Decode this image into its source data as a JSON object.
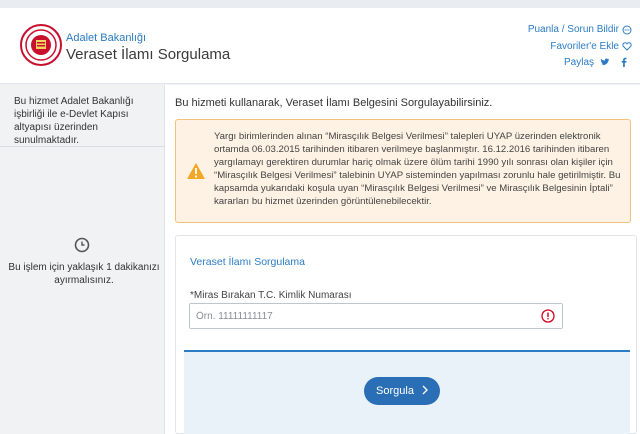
{
  "header": {
    "agency": "Adalet Bakanlığı",
    "service_title": "Veraset İlamı Sorgulama",
    "rate_report": "Puanla / Sorun Bildir",
    "add_favorites": "Favoriler'e Ekle",
    "share": "Paylaş"
  },
  "sidebar": {
    "info": "Bu hizmet Adalet Bakanlığı işbirliği ile e-Devlet Kapısı altyapısı üzerinden sunulmaktadır.",
    "time_notice": "Bu işlem için yaklaşık 1 dakikanızı ayırmalısınız."
  },
  "main": {
    "intro": "Bu hizmeti kullanarak, Veraset İlamı Belgesini Sorgulayabilirsiniz.",
    "warning": "Yargı birimlerinden alınan “Mirasçılık Belgesi Verilmesi” talepleri UYAP üzerinden elektronik ortamda 06.03.2015 tarihinden itibaren verilmeye başlanmıştır. 16.12.2016 tarihinden itibaren yargılamayı gerektiren durumlar hariç olmak üzere ölüm tarihi 1990 yılı sonrası olan kişiler için “Mirasçılık Belgesi Verilmesi” talebinin UYAP sisteminden yapılması zorunlu hale getirilmiştir. Bu kapsamda yukarıdaki koşula uyan “Mirasçılık Belgesi Verilmesi” ve Mirasçılık Belgesinin İptali” kararları bu hizmet üzerinden görüntülenebilecektir."
  },
  "form": {
    "title": "Veraset İlamı Sorgulama",
    "field_label": "*Miras Bırakan T.C. Kimlik Numarası",
    "field_value": "",
    "field_placeholder": "Örn. 11111111117",
    "submit_label": "Sorgula"
  },
  "colors": {
    "accent": "#2b7cc4",
    "button": "#2a6fb5",
    "warning_bg": "#fdf2e3",
    "warning_border": "#f1c27d",
    "warning_icon": "#f5a623",
    "error_icon": "#d0021b"
  },
  "icons": [
    "ministry-logo",
    "comment-icon",
    "heart-icon",
    "twitter-icon",
    "facebook-icon",
    "clock-icon",
    "warning-icon",
    "error-icon",
    "chevron-right-icon"
  ]
}
